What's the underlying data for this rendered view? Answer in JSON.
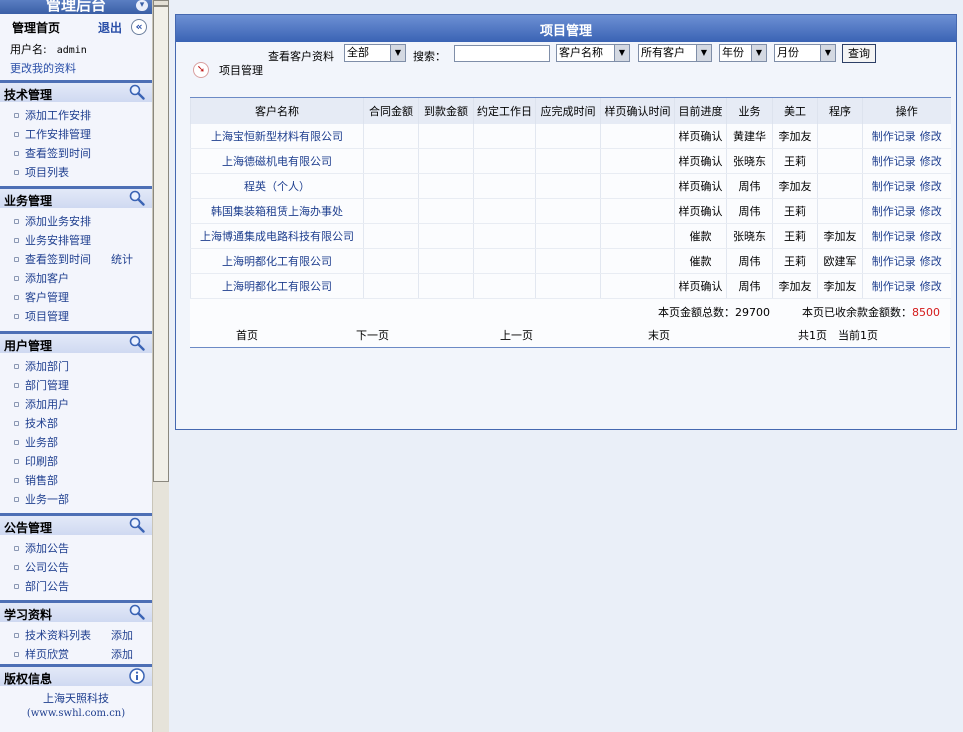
{
  "sidebar": {
    "title": "管理后台",
    "home": "管理首页",
    "logout": "退出",
    "toggle_glyph": "«",
    "user_label": "用户名:",
    "user_name": "admin",
    "edit_profile": "更改我的资料",
    "sections": [
      {
        "title": "技术管理",
        "icon": "search-icon",
        "items": [
          {
            "label": "添加工作安排",
            "extra": ""
          },
          {
            "label": "工作安排管理",
            "extra": ""
          },
          {
            "label": "查看签到时间",
            "extra": ""
          },
          {
            "label": "项目列表",
            "extra": ""
          }
        ]
      },
      {
        "title": "业务管理",
        "icon": "search-icon",
        "items": [
          {
            "label": "添加业务安排",
            "extra": ""
          },
          {
            "label": "业务安排管理",
            "extra": ""
          },
          {
            "label": "查看签到时间",
            "extra": "统计"
          },
          {
            "label": "添加客户",
            "extra": ""
          },
          {
            "label": "客户管理",
            "extra": ""
          },
          {
            "label": "项目管理",
            "extra": ""
          }
        ]
      },
      {
        "title": "用户管理",
        "icon": "search-icon",
        "items": [
          {
            "label": "添加部门",
            "extra": ""
          },
          {
            "label": "部门管理",
            "extra": ""
          },
          {
            "label": "添加用户",
            "extra": ""
          },
          {
            "label": "技术部",
            "extra": ""
          },
          {
            "label": "业务部",
            "extra": ""
          },
          {
            "label": "印刷部",
            "extra": ""
          },
          {
            "label": "销售部",
            "extra": ""
          },
          {
            "label": "业务一部",
            "extra": ""
          }
        ]
      },
      {
        "title": "公告管理",
        "icon": "search-icon",
        "items": [
          {
            "label": "添加公告",
            "extra": ""
          },
          {
            "label": "公司公告",
            "extra": ""
          },
          {
            "label": "部门公告",
            "extra": ""
          }
        ]
      },
      {
        "title": "学习资料",
        "icon": "search-icon",
        "items": [
          {
            "label": "技术资料列表",
            "extra": "添加"
          },
          {
            "label": "样页欣赏",
            "extra": "添加"
          }
        ]
      },
      {
        "title": "版权信息",
        "icon": "info-icon",
        "items": []
      }
    ],
    "copyright_company": "上海天照科技",
    "copyright_site": "(www.swhl.com.cn)"
  },
  "panel": {
    "title": "项目管理",
    "search": {
      "view_label": "查看客户资料",
      "scope_select": "全部",
      "search_label": "搜索：",
      "search_value": "",
      "field_select": "客户名称",
      "client_select": "所有客户",
      "year_select": "年份",
      "month_select": "月份",
      "query_button": "查询"
    },
    "breadcrumb": "项目管理",
    "columns": [
      "客户名称",
      "合同金额",
      "到款金额",
      "约定工作日",
      "应完成时间",
      "样页确认时间",
      "目前进度",
      "业务",
      "美工",
      "程序",
      "操作"
    ],
    "rows": [
      {
        "client": "上海宝恒新型材料有限公司",
        "contract": "",
        "received": "",
        "workdays": "",
        "due": "",
        "confirm": "",
        "progress": "样页确认",
        "sales": "黄建华",
        "artist": "李加友",
        "programmer": "",
        "op1": "制作记录",
        "op2": "修改"
      },
      {
        "client": "上海德磁机电有限公司",
        "contract": "",
        "received": "",
        "workdays": "",
        "due": "",
        "confirm": "",
        "progress": "样页确认",
        "sales": "张晓东",
        "artist": "王莉",
        "programmer": "",
        "op1": "制作记录",
        "op2": "修改"
      },
      {
        "client": "程英（个人）",
        "contract": "",
        "received": "",
        "workdays": "",
        "due": "",
        "confirm": "",
        "progress": "样页确认",
        "sales": "周伟",
        "artist": "李加友",
        "programmer": "",
        "op1": "制作记录",
        "op2": "修改"
      },
      {
        "client": "韩国集装箱租赁上海办事处",
        "contract": "",
        "received": "",
        "workdays": "",
        "due": "",
        "confirm": "",
        "progress": "样页确认",
        "sales": "周伟",
        "artist": "王莉",
        "programmer": "",
        "op1": "制作记录",
        "op2": "修改"
      },
      {
        "client": "上海博通集成电路科技有限公司",
        "contract": "",
        "received": "",
        "workdays": "",
        "due": "",
        "confirm": "",
        "progress": "催款",
        "sales": "张晓东",
        "artist": "王莉",
        "programmer": "李加友",
        "op1": "制作记录",
        "op2": "修改"
      },
      {
        "client": "上海明都化工有限公司",
        "contract": "",
        "received": "",
        "workdays": "",
        "due": "",
        "confirm": "",
        "progress": "催款",
        "sales": "周伟",
        "artist": "王莉",
        "programmer": "欧建军",
        "op1": "制作记录",
        "op2": "修改"
      },
      {
        "client": "上海明都化工有限公司",
        "contract": "",
        "received": "",
        "workdays": "",
        "due": "",
        "confirm": "",
        "progress": "样页确认",
        "sales": "周伟",
        "artist": "李加友",
        "programmer": "李加友",
        "op1": "制作记录",
        "op2": "修改"
      }
    ],
    "summary": {
      "total_label": "本页金额总数：",
      "total_value": "29700",
      "remaining_label": "本页已收余款金额数：",
      "remaining_value": "8500"
    },
    "pager": {
      "first": "首页",
      "next": "下一页",
      "prev": "上一页",
      "last": "末页",
      "total_pages": "共1页",
      "current_page": "当前1页"
    }
  },
  "colors": {
    "header_blue": "#3a63b4",
    "link_blue": "#1f3f8f",
    "highlight_red": "#d41a1a"
  }
}
